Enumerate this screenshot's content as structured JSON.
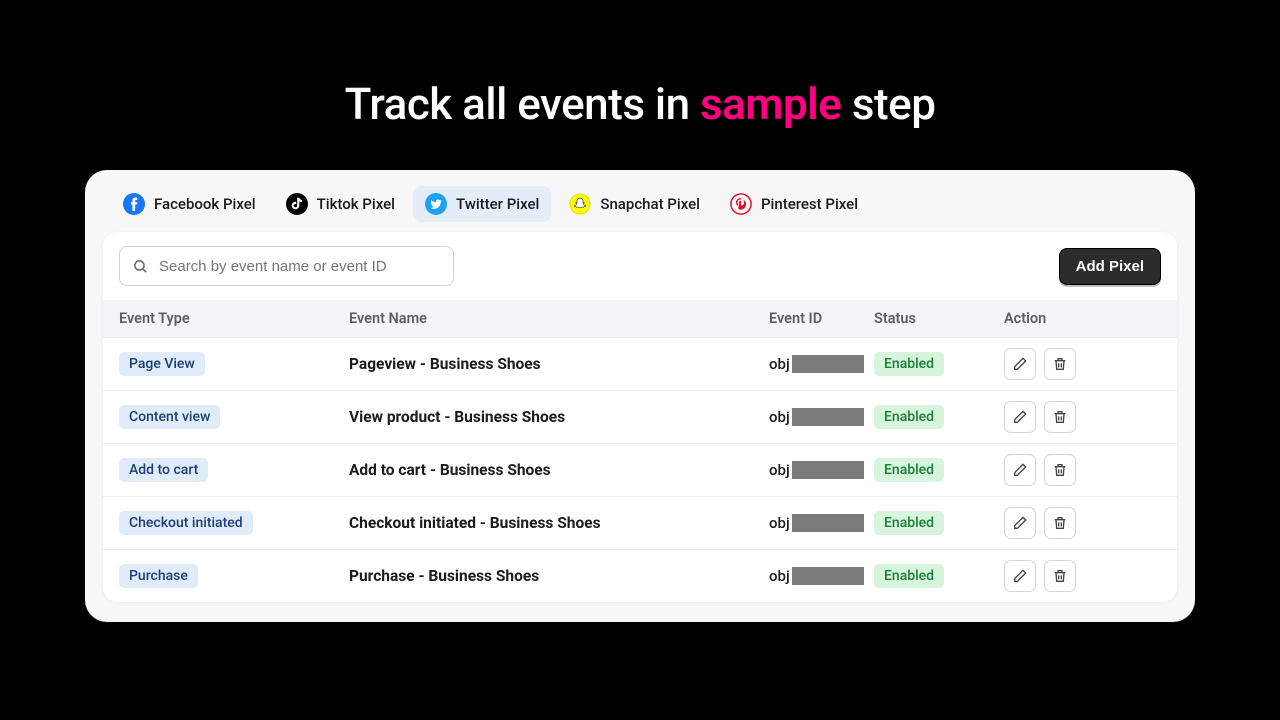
{
  "headline": {
    "pre": "Track all events in ",
    "accent": "sample",
    "post": " step"
  },
  "tabs": [
    {
      "label": "Facebook Pixel"
    },
    {
      "label": "Tiktok Pixel"
    },
    {
      "label": "Twitter Pixel"
    },
    {
      "label": "Snapchat Pixel"
    },
    {
      "label": "Pinterest Pixel"
    }
  ],
  "active_tab_index": 2,
  "search": {
    "placeholder": "Search by event name or event ID"
  },
  "buttons": {
    "add_pixel": "Add Pixel"
  },
  "columns": {
    "type": "Event Type",
    "name": "Event Name",
    "id": "Event ID",
    "status": "Status",
    "action": "Action"
  },
  "rows": [
    {
      "type": "Page View",
      "name": "Pageview - Business Shoes",
      "id_prefix": "obj",
      "status": "Enabled"
    },
    {
      "type": "Content view",
      "name": "View product - Business Shoes",
      "id_prefix": "obj",
      "status": "Enabled"
    },
    {
      "type": "Add to cart",
      "name": "Add to cart - Business Shoes",
      "id_prefix": "obj",
      "status": "Enabled"
    },
    {
      "type": "Checkout initiated",
      "name": "Checkout initiated - Business Shoes",
      "id_prefix": "obj",
      "status": "Enabled"
    },
    {
      "type": "Purchase",
      "name": "Purchase - Business Shoes",
      "id_prefix": "obj",
      "status": "Enabled"
    }
  ]
}
